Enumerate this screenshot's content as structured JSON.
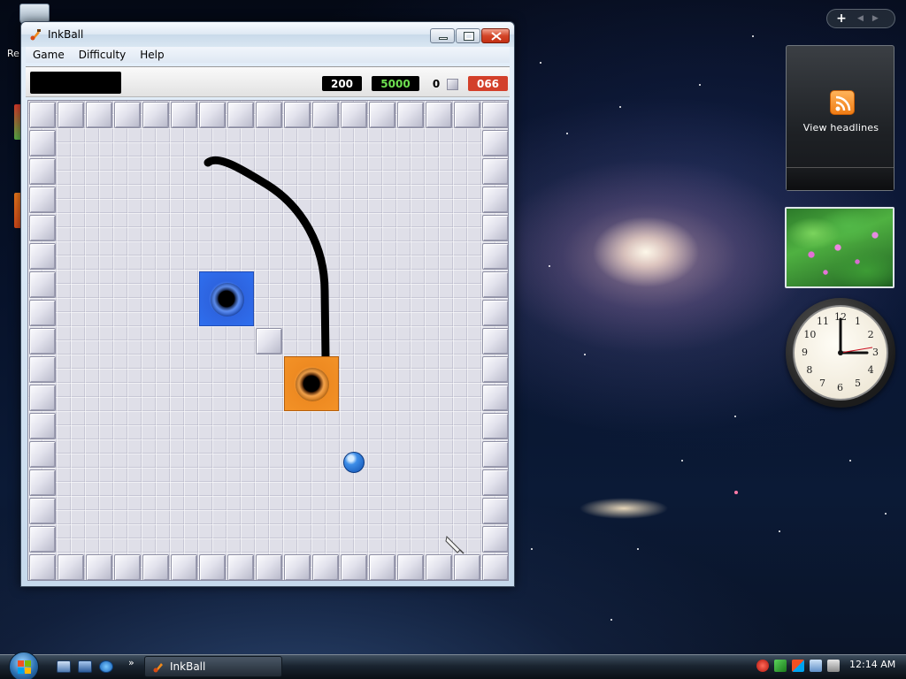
{
  "window": {
    "title": "InkBall",
    "controls": [
      "minimize",
      "maximize",
      "close"
    ]
  },
  "menu": {
    "items": [
      "Game",
      "Difficulty",
      "Help"
    ]
  },
  "scores": {
    "score": "200",
    "target": "5000",
    "count": "0",
    "timer": "066"
  },
  "board": {
    "grid_size": 17,
    "holes": [
      {
        "color": "blue",
        "col": 6,
        "row": 6
      },
      {
        "color": "orange",
        "col": 9,
        "row": 9
      }
    ],
    "balls": [
      {
        "color": "blue"
      }
    ],
    "inner_tiles": [
      {
        "col": 8,
        "row": 8
      }
    ],
    "colors": {
      "blue": "#2f6fef",
      "orange": "#f39227",
      "tile": "#dcdce6",
      "ink": "#000000"
    }
  },
  "sidebar": {
    "feed_label": "View headlines"
  },
  "taskbar": {
    "task_label": "InkBall",
    "chevrons": "»",
    "time": "12:14 AM"
  },
  "desktop": {
    "icon_label": "Re"
  },
  "clock": {
    "numbers": [
      "12",
      "1",
      "2",
      "3",
      "4",
      "5",
      "6",
      "7",
      "8",
      "9",
      "10",
      "11"
    ]
  }
}
